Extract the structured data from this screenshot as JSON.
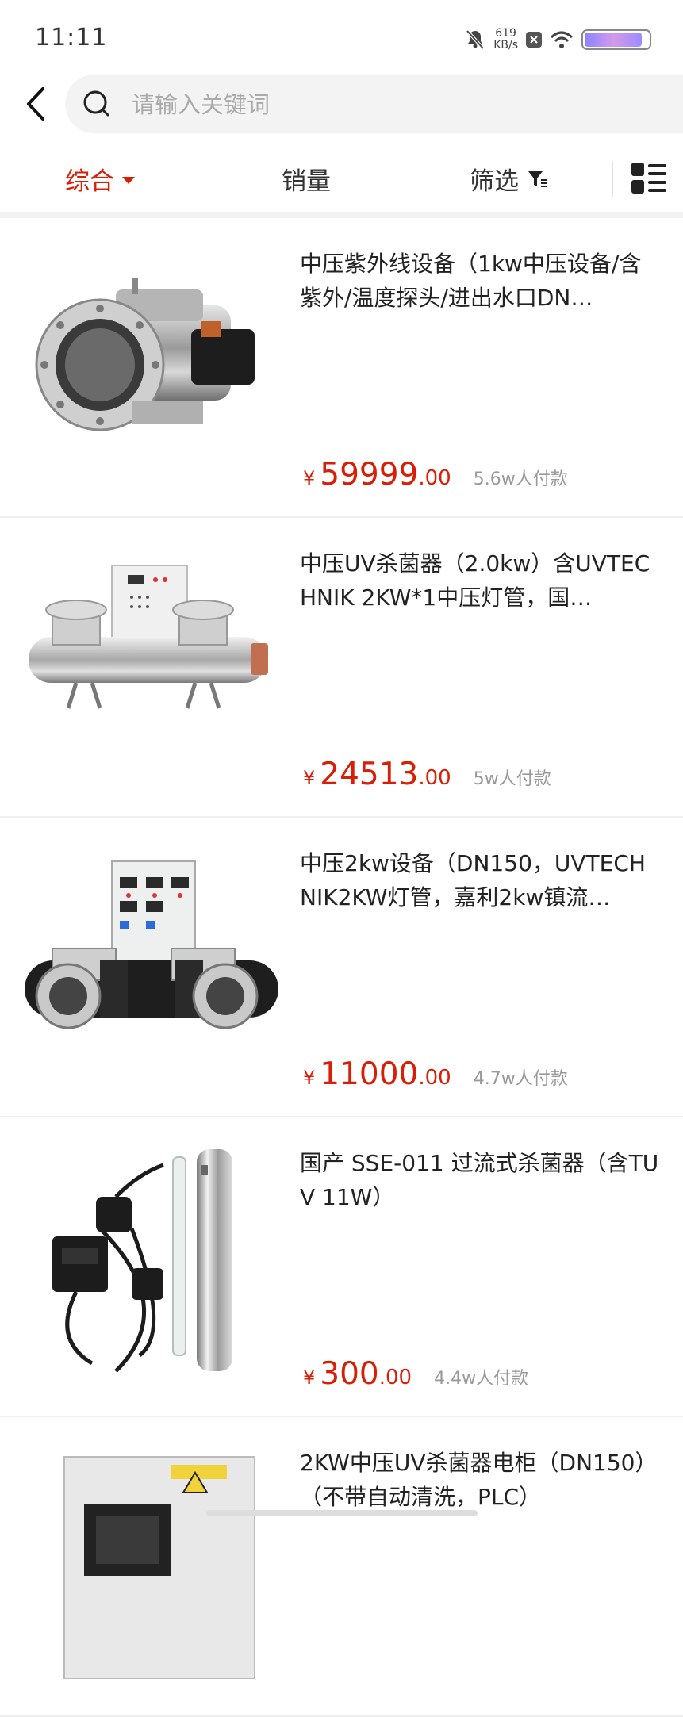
{
  "status": {
    "time": "11:11",
    "net_speed_value": "619",
    "net_speed_unit": "KB/s",
    "battery_level": 0.9
  },
  "search": {
    "placeholder": "请输入关键词"
  },
  "sort": {
    "tabs": [
      {
        "label": "综合",
        "active": true
      },
      {
        "label": "销量",
        "active": false
      },
      {
        "label": "筛选",
        "active": false
      }
    ]
  },
  "products": [
    {
      "title": "中压紫外线设备（1kw中压设备/含紫外/温度探头/进出水口DN…",
      "currency": "¥",
      "price_int": "59999",
      "price_dec": ".00",
      "sold": "5.6w人付款",
      "image": "uv-reactor-flanged"
    },
    {
      "title": "中压UV杀菌器（2.0kw）含UVTECHNIK 2KW*1中压灯管，国…",
      "currency": "¥",
      "price_int": "24513",
      "price_dec": ".00",
      "sold": "5w人付款",
      "image": "uv-sterilizer-cabinet"
    },
    {
      "title": "中压2kw设备（DN150，UVTECHNIK2KW灯管，嘉利2kw镇流…",
      "currency": "¥",
      "price_int": "11000",
      "price_dec": ".00",
      "sold": "4.7w人付款",
      "image": "uv-double-reactor"
    },
    {
      "title": "国产 SSE-011 过流式杀菌器（含TUV 11W）",
      "currency": "¥",
      "price_int": "300",
      "price_dec": ".00",
      "sold": "4.4w人付款",
      "image": "small-uv-sterilizer"
    },
    {
      "title": "2KW中压UV杀菌器电柜（DN150）（不带自动清洗，PLC）",
      "currency": "¥",
      "price_int": "",
      "price_dec": "",
      "sold": "",
      "image": "uv-control-cabinet"
    }
  ]
}
